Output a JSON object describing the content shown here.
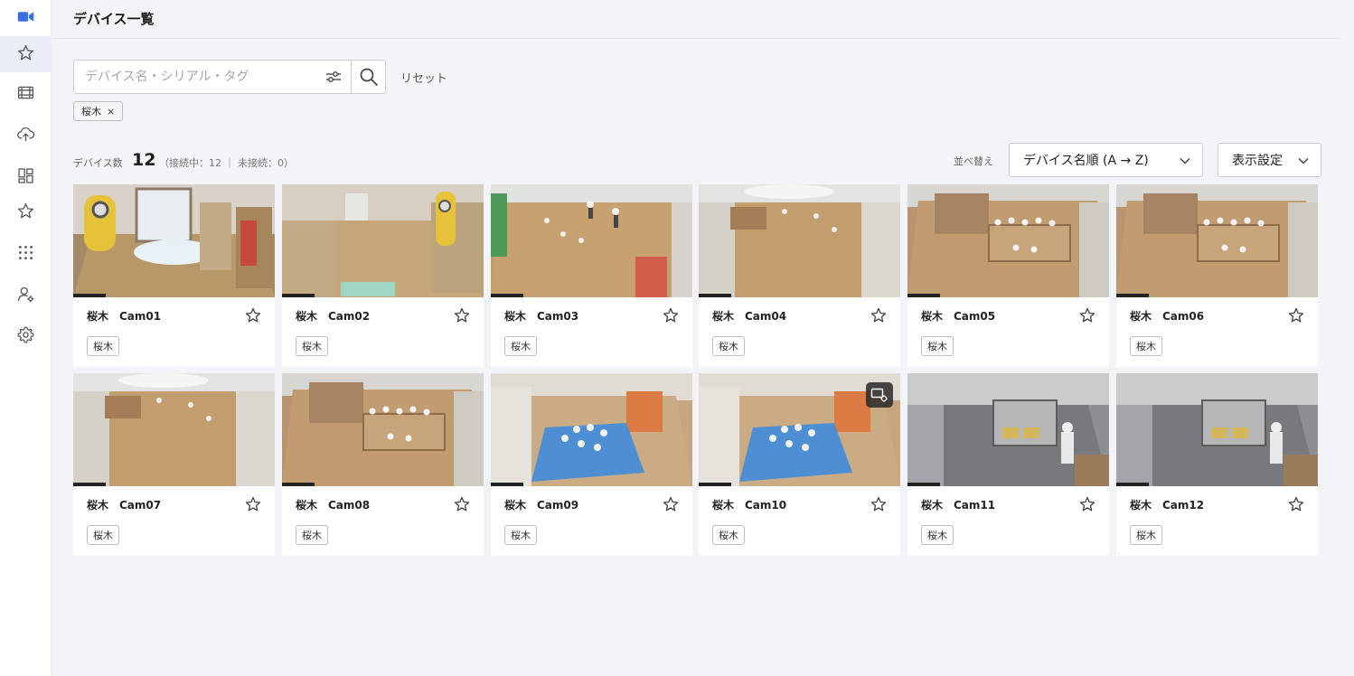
{
  "page": {
    "title": "デバイス一覧"
  },
  "sidebar": {
    "items": [
      {
        "icon": "video-camera-icon",
        "active": true
      },
      {
        "icon": "star-icon"
      },
      {
        "icon": "film-icon"
      },
      {
        "icon": "cloud-upload-icon"
      },
      {
        "icon": "dashboard-layout-icon"
      },
      {
        "icon": "star-icon"
      },
      {
        "icon": "apps-grid-icon"
      },
      {
        "icon": "user-settings-icon"
      },
      {
        "icon": "gear-icon"
      }
    ]
  },
  "search": {
    "placeholder": "デバイス名・シリアル・タグ",
    "value": "",
    "reset_label": "リセット"
  },
  "filters": {
    "active_tag": "桜木",
    "remove_symbol": "×"
  },
  "summary": {
    "count_label": "デバイス数",
    "count": "12",
    "detail": "（接続中：12 ｜ 未接続：0）"
  },
  "sort": {
    "label": "並べ替え",
    "selected": "デバイス名順 (A → Z)"
  },
  "view": {
    "selected": "表示設定"
  },
  "colors": {
    "accent": "#3b6fe0",
    "card_bg": "#ffffff",
    "page_bg": "#f3f4f7"
  },
  "devices": [
    {
      "name": "桜木　Cam01",
      "tag": "桜木",
      "scene": "hall-door"
    },
    {
      "name": "桜木　Cam02",
      "tag": "桜木",
      "scene": "hall-corridor"
    },
    {
      "name": "桜木　Cam03",
      "tag": "桜木",
      "scene": "room-kids"
    },
    {
      "name": "桜木　Cam04",
      "tag": "桜木",
      "scene": "room-wide"
    },
    {
      "name": "桜木　Cam05",
      "tag": "桜木",
      "scene": "room-table"
    },
    {
      "name": "桜木　Cam06",
      "tag": "桜木",
      "scene": "room-table"
    },
    {
      "name": "桜木　Cam07",
      "tag": "桜木",
      "scene": "room-wide"
    },
    {
      "name": "桜木　Cam08",
      "tag": "桜木",
      "scene": "room-table"
    },
    {
      "name": "桜木　Cam09",
      "tag": "桜木",
      "scene": "mat"
    },
    {
      "name": "桜木　Cam10",
      "tag": "桜木",
      "scene": "mat",
      "overlay_icon": "camera-settings-icon"
    },
    {
      "name": "桜木　Cam11",
      "tag": "桜木",
      "scene": "kitchen"
    },
    {
      "name": "桜木　Cam12",
      "tag": "桜木",
      "scene": "kitchen"
    }
  ]
}
